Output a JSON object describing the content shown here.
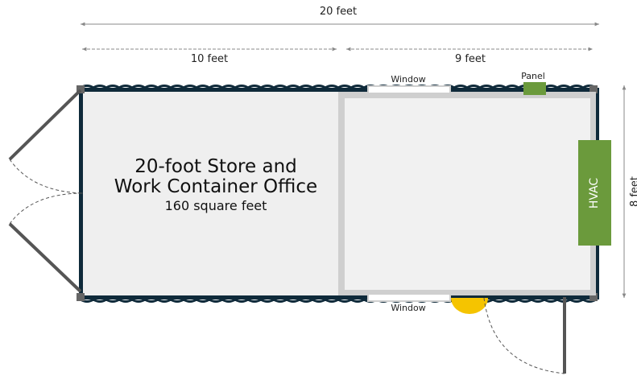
{
  "dimensions": {
    "overall_width": "20 feet",
    "storage_width": "10 feet",
    "office_width": "9 feet",
    "depth": "8 feet"
  },
  "room": {
    "title_line1": "20-foot Store and",
    "title_line2": "Work Container Office",
    "area": "160 square feet"
  },
  "features": {
    "window_top": "Window",
    "window_bottom": "Window",
    "panel": "Panel",
    "hvac": "HVAC"
  },
  "colors": {
    "container_wall": "#0f2a3a",
    "floor": "#efefef",
    "partition": "#cfcfcf",
    "hvac": "#6b9a3c",
    "panel": "#6b9a3c",
    "fixture": "#f5c400",
    "door": "#555555"
  }
}
